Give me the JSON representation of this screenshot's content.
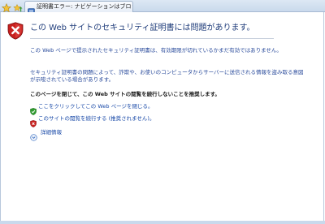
{
  "browser": {
    "tab_title": "証明書エラー: ナビゲーションはブロックされ..."
  },
  "page": {
    "heading": "この Web サイトのセキュリティ証明書には問題があります。",
    "paragraph1": "この Web ページで提示されたセキュリティ証明書は、有効期限が切れているかまだ有効ではありません。",
    "paragraph2": "セキュリティ証明書の問題によって、詐欺や、お使いのコンピュータからサーバーに送信される情報を盗み取る意図が示唆されている場合があります。",
    "recommendation": "このページを閉じて、この Web サイトの閲覧を続行しないことを推奨します。",
    "close_link": "ここをクリックしてこの Web ページを閉じる。",
    "continue_link": "このサイトの閲覧を続行する (推奨されません)。",
    "more_info": "詳細情報"
  },
  "colors": {
    "heading": "#1f3c7a",
    "body_text": "#2b4c9c",
    "link": "#1a4aa8",
    "error_red": "#c8201e",
    "ok_green": "#2e9a2e"
  },
  "icons": {
    "favorites": "favorites-star-icon",
    "add_favorites": "add-favorites-icon",
    "tab": "certificate-error-icon",
    "shield": "error-shield-icon",
    "close_link": "green-shield-icon",
    "continue_link": "red-shield-icon",
    "more_info": "expand-circle-icon"
  }
}
